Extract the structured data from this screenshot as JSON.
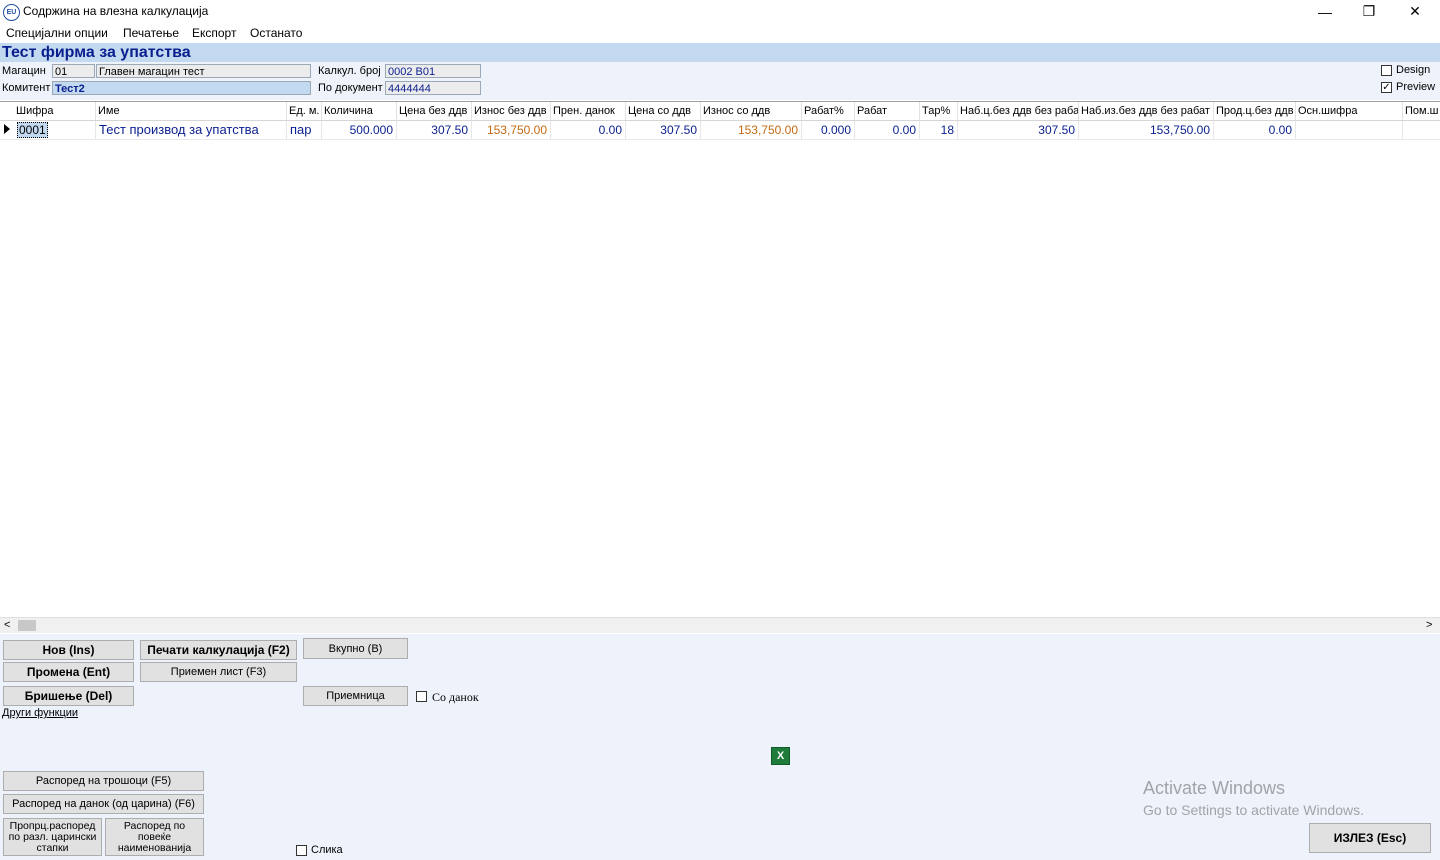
{
  "window": {
    "title": "Содржина на влезна калкулација",
    "app_icon_text": "EU",
    "minimize": "—",
    "restore": "❐",
    "close": "✕"
  },
  "menu": [
    "Специјални опции",
    "Печатење",
    "Експорт",
    "Останато"
  ],
  "company": "Тест фирма за упатства",
  "form": {
    "warehouse_label": "Магацин",
    "warehouse_code": "01",
    "warehouse_name": "Главен магацин тест",
    "client_label": "Комитент",
    "client_value": "Тест2",
    "calc_no_label": "Калкул. број",
    "calc_no_value": "0002   В01",
    "doc_label": "По документ",
    "doc_value": "4444444",
    "design_label": "Design",
    "design_checked": false,
    "preview_label": "Preview",
    "preview_checked": true
  },
  "grid": {
    "columns": [
      "Шифра",
      "Име",
      "Ед. м.",
      "Количина",
      "Цена без ддв",
      "Износ без ддв",
      "Прен. данок",
      "Цена со ддв",
      "Износ со ддв",
      "Рабат%",
      "Рабат",
      "Тар%",
      "Наб.ц.без ддв без рабат",
      "Наб.из.без ддв без рабат",
      "Прод.ц.без ддв",
      "Осн.шифра",
      "Пом.ш"
    ],
    "rows": [
      [
        "0001",
        "Тест производ за упатства",
        "пар",
        "500.000",
        "307.50",
        "153,750.00",
        "0.00",
        "307.50",
        "153,750.00",
        "0.000",
        "0.00",
        "18",
        "307.50",
        "153,750.00",
        "0.00",
        "",
        ""
      ]
    ]
  },
  "buttons": {
    "new": "Нов (Ins)",
    "print_calc": "Печати калкулација (F2)",
    "total": "Вкупно (B)",
    "edit": "Промена (Ent)",
    "receipt_list": "Приемен лист (F3)",
    "delete": "Бришење (Del)",
    "receipt": "Приемница",
    "with_tax": "Со данок",
    "other_functions": "Други функции",
    "cost_dist": "Распоред на трошоци (F5)",
    "tax_dist": "Распоред на данок (од царина) (F6)",
    "prop_dist": "Пропрц.распоред по разл. царински стапки",
    "multi_dist": "Распоред по повеќе наименованија",
    "image": "Слика",
    "exit": "ИЗЛЕЗ (Esc)"
  },
  "watermark": {
    "line1": "Activate Windows",
    "line2": "Go to Settings to activate Windows."
  },
  "colors": {
    "band": "#c3d9ef",
    "panel": "#eef3fb",
    "accent_text": "#0a1f8f",
    "amount_orange": "#c46a12"
  }
}
